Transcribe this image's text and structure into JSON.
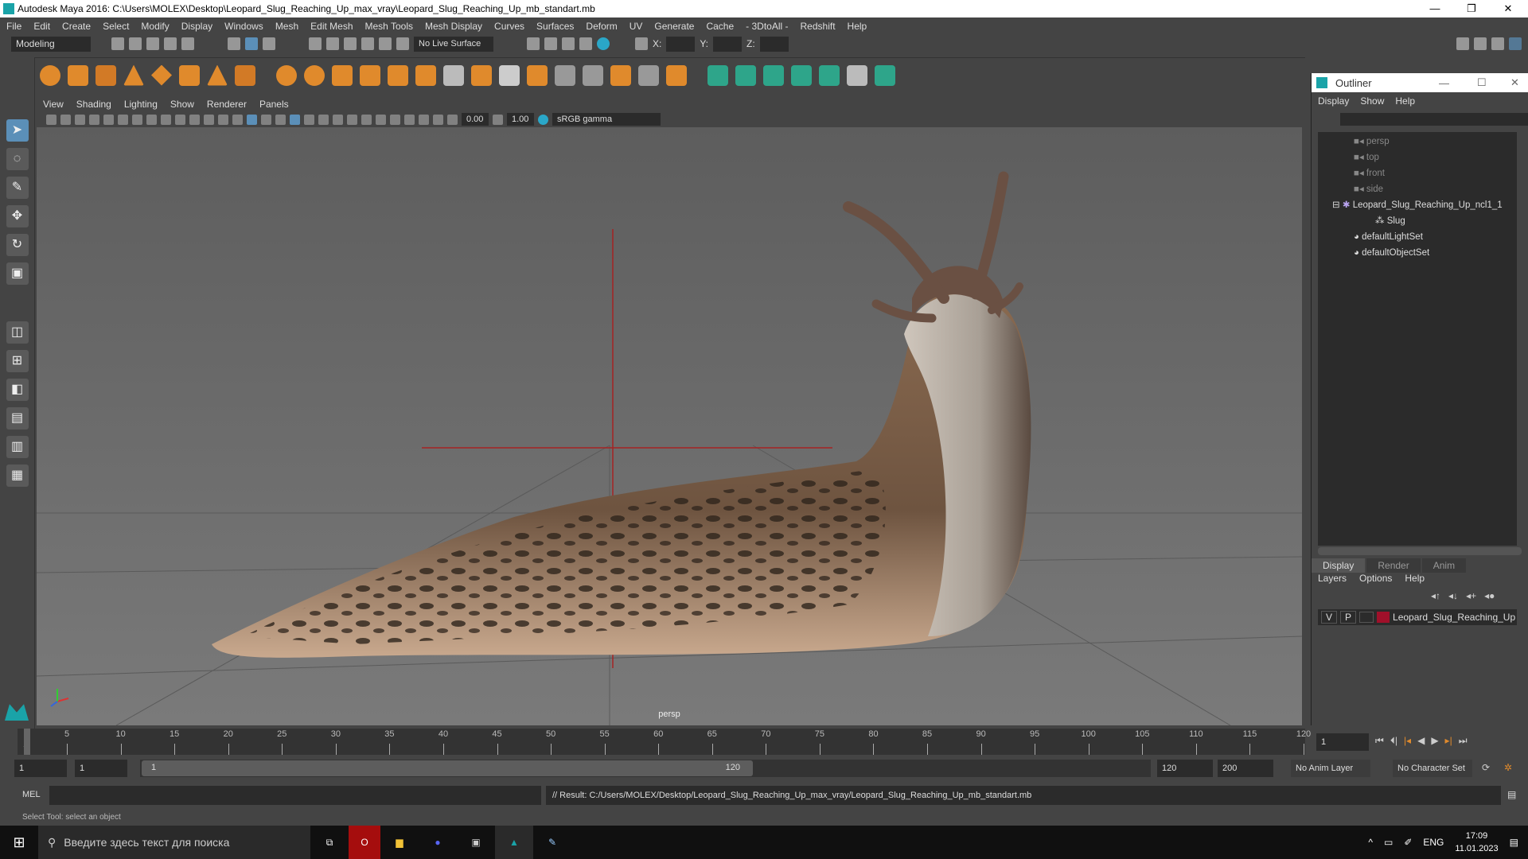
{
  "title": "Autodesk Maya 2016: C:\\Users\\MOLEX\\Desktop\\Leopard_Slug_Reaching_Up_max_vray\\Leopard_Slug_Reaching_Up_mb_standart.mb",
  "menu": [
    "File",
    "Edit",
    "Create",
    "Select",
    "Modify",
    "Display",
    "Windows",
    "Mesh",
    "Edit Mesh",
    "Mesh Tools",
    "Mesh Display",
    "Curves",
    "Surfaces",
    "Deform",
    "UV",
    "Generate",
    "Cache",
    "- 3DtoAll -",
    "Redshift",
    "Help"
  ],
  "status": {
    "mode": "Modeling",
    "live_surface": "No Live Surface",
    "x_label": "X:",
    "y_label": "Y:",
    "z_label": "Z:"
  },
  "viewport": {
    "menu": [
      "View",
      "Shading",
      "Lighting",
      "Show",
      "Renderer",
      "Panels"
    ],
    "exposure": "0.00",
    "gamma": "1.00",
    "color_space": "sRGB gamma",
    "camera_label": "persp"
  },
  "outliner": {
    "title": "Outliner",
    "menu": [
      "Display",
      "Show",
      "Help"
    ],
    "items": [
      "persp",
      "top",
      "front",
      "side",
      "Leopard_Slug_Reaching_Up_ncl1_1",
      "Slug",
      "defaultLightSet",
      "defaultObjectSet"
    ]
  },
  "layers": {
    "tabs": [
      "Display",
      "Render",
      "Anim"
    ],
    "menu": [
      "Layers",
      "Options",
      "Help"
    ],
    "v": "V",
    "p": "P",
    "layer_name": "Leopard_Slug_Reaching_Up",
    "layer_color": "#a0102a"
  },
  "timeline": {
    "ticks": [
      "5",
      "10",
      "15",
      "20",
      "25",
      "30",
      "35",
      "40",
      "45",
      "50",
      "55",
      "60",
      "65",
      "70",
      "75",
      "80",
      "85",
      "90",
      "95",
      "100",
      "105",
      "110",
      "115",
      "120"
    ],
    "start_marker": "1",
    "current_frame": "1"
  },
  "range": {
    "start": "1",
    "playback_start": "1",
    "slider_start": "1",
    "slider_end": "120",
    "playback_end": "120",
    "end": "200",
    "anim_layer": "No Anim Layer",
    "char_set": "No Character Set"
  },
  "cmd": {
    "label": "MEL",
    "result": "// Result: C:/Users/MOLEX/Desktop/Leopard_Slug_Reaching_Up_max_vray/Leopard_Slug_Reaching_Up_mb_standart.mb"
  },
  "help_line": "Select Tool: select an object",
  "taskbar": {
    "search": "Введите здесь текст для поиска",
    "lang": "ENG",
    "time": "17:09",
    "date": "11.01.2023"
  }
}
